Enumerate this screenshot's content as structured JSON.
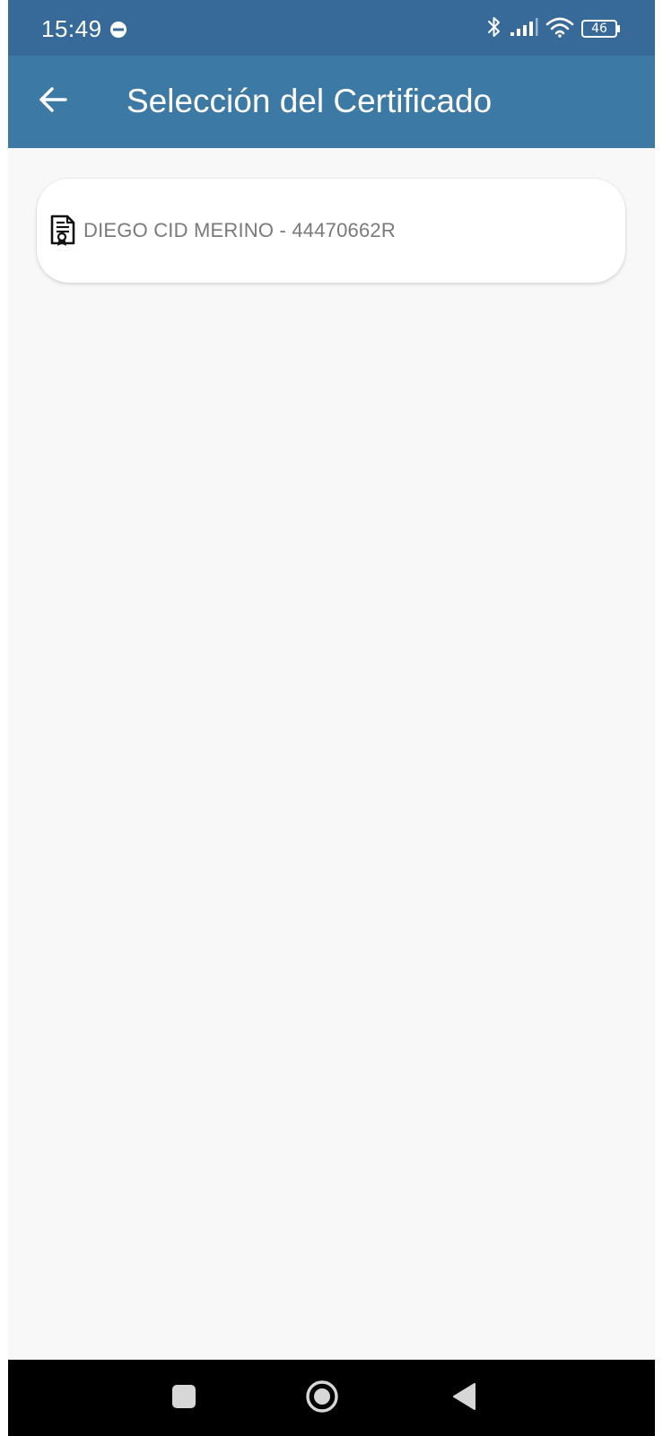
{
  "status_bar": {
    "time": "15:49",
    "battery_level": "46",
    "icons": [
      "dnd-icon",
      "bluetooth-icon",
      "signal-icon",
      "wifi-icon",
      "battery-icon"
    ]
  },
  "app_bar": {
    "title": "Selección del Certificado",
    "back_icon": "arrow-left-icon"
  },
  "certificates": [
    {
      "label": "DIEGO CID MERINO - 44470662R",
      "icon": "certificate-icon"
    }
  ],
  "nav_bar": {
    "icons": [
      "recents-square-icon",
      "home-circle-icon",
      "back-triangle-icon"
    ]
  },
  "colors": {
    "status_bar": "#376a98",
    "app_bar": "#3c79a5",
    "background": "#f8f8f8",
    "card": "#ffffff",
    "card_text": "#7a7a7a",
    "nav_bar": "#000000"
  }
}
